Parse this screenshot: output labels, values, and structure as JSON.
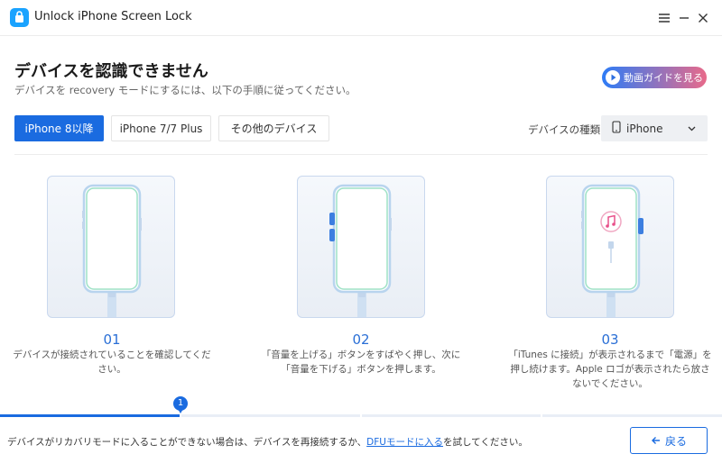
{
  "window": {
    "title": "Unlock iPhone Screen Lock"
  },
  "header": {
    "title": "デバイスを認識できません",
    "subtitle": "デバイスを recovery モードにするには、以下の手順に従ってください。",
    "video_guide_label": "動画ガイドを見る"
  },
  "tabs": [
    {
      "label": "iPhone 8以降",
      "active": true
    },
    {
      "label": "iPhone 7/7 Plus",
      "active": false
    },
    {
      "label": "その他のデバイス",
      "active": false
    }
  ],
  "device_type": {
    "label": "デバイスの種類:",
    "selected": "iPhone"
  },
  "steps": [
    {
      "number": "01",
      "line1": "デバイスが接続されていることを確認してくだ",
      "line2": "さい。",
      "line3": ""
    },
    {
      "number": "02",
      "line1": "「音量を上げる」ボタンをすばやく押し、次に",
      "line2": "「音量を下げる」ボタンを押します。",
      "line3": ""
    },
    {
      "number": "03",
      "line1": "「iTunes に接続」が表示されるまで「電源」を",
      "line2": "押し続けます。Apple ロゴが表示されたら放さ",
      "line3": "ないでください。"
    }
  ],
  "progress": {
    "current_step": "1",
    "fraction": 0.25
  },
  "footer": {
    "text_before": "デバイスがリカバリモードに入ることができない場合は、デバイスを再接続するか、",
    "link": "DFUモードに入る",
    "text_after": "を試してください。",
    "back_label": "戻る"
  },
  "colors": {
    "accent": "#1a6be0",
    "highlight_button": "#3d7fe0",
    "phone_outline": "#b8d4ee",
    "screen_glow": "#7ed9b8"
  }
}
